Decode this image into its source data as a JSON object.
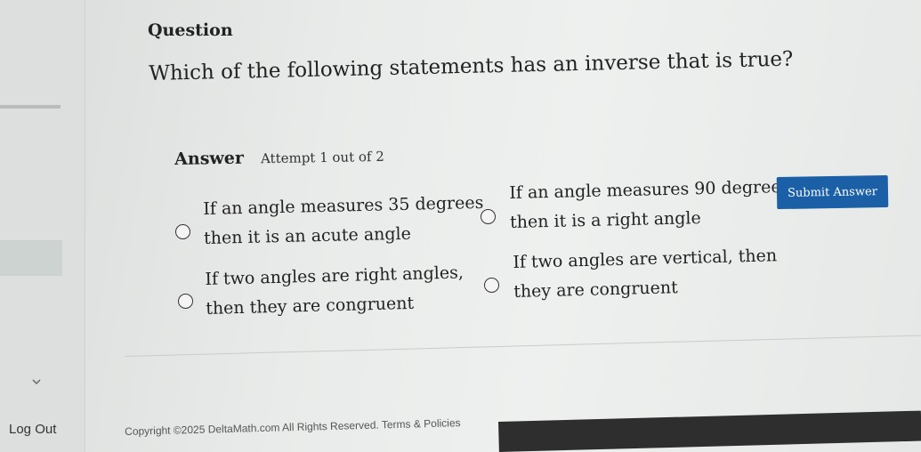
{
  "question": {
    "label": "Question",
    "text": "Which of the following statements has an inverse that is true?"
  },
  "answer": {
    "label": "Answer",
    "attempt": "Attempt 1 out of 2"
  },
  "options": [
    {
      "line1": "If an angle measures 35 degrees",
      "line2": "then it is an acute angle"
    },
    {
      "line1": "If an angle measures 90 degrees,",
      "line2": "then it is a right angle"
    },
    {
      "line1": "If two angles are right angles,",
      "line2": "then they are congruent"
    },
    {
      "line1": "If two angles are vertical, then",
      "line2": "they are congruent"
    }
  ],
  "submit_label": "Submit Answer",
  "sidebar": {
    "logout_label": "Log Out"
  },
  "footer": {
    "copyright": "Copyright ©2025 DeltaMath.com All Rights Reserved.",
    "terms": "Terms & Policies"
  },
  "colors": {
    "accent": "#1b5fa6"
  },
  "icons": {
    "chevron": "chevron-down-icon",
    "radio": "radio-button-icon"
  }
}
